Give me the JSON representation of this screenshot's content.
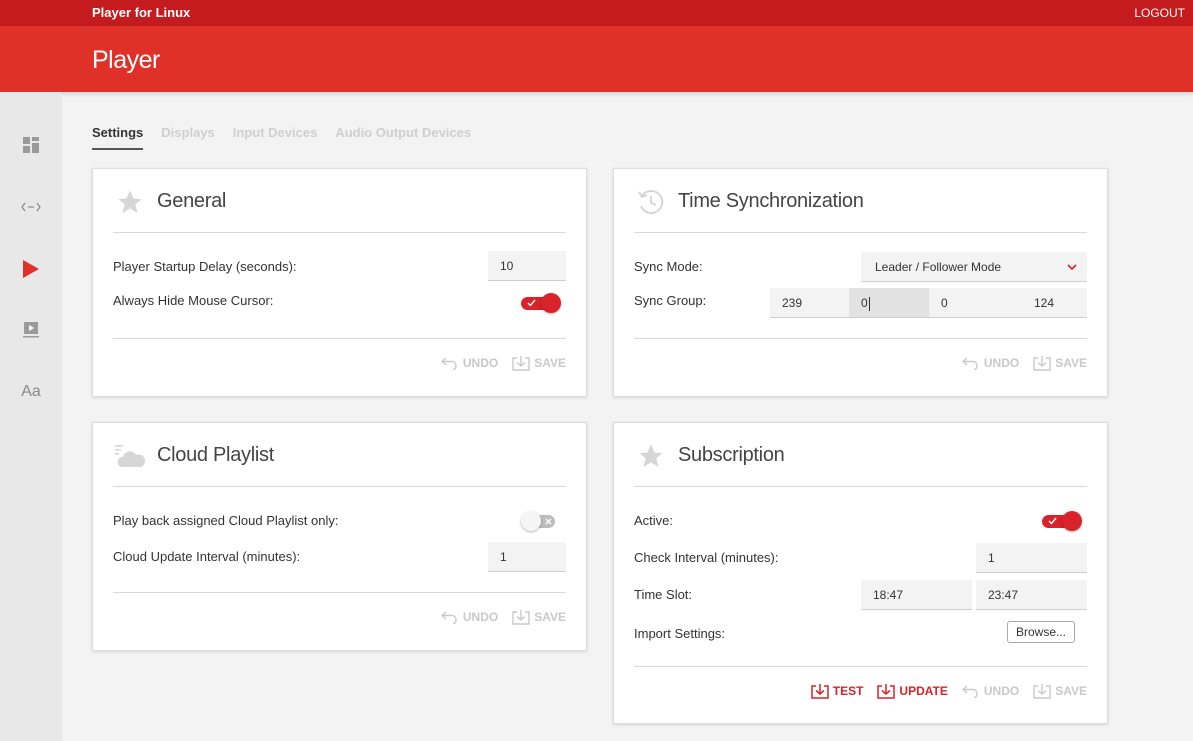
{
  "topbar": {
    "app_name": "Player for Linux",
    "logout": "LOGOUT"
  },
  "header": {
    "title": "Player"
  },
  "sidebar": {
    "items": [
      {
        "name": "dashboard-icon"
      },
      {
        "name": "code-arrows-icon"
      },
      {
        "name": "play-icon",
        "active": true
      },
      {
        "name": "presentation-icon"
      },
      {
        "name": "font-icon",
        "label": "Aa"
      }
    ]
  },
  "tabs": [
    "Settings",
    "Displays",
    "Input Devices",
    "Audio Output Devices"
  ],
  "general": {
    "title": "General",
    "startup_delay_label": "Player Startup Delay (seconds):",
    "startup_delay_value": "10",
    "hide_cursor_label": "Always Hide Mouse Cursor:",
    "hide_cursor_on": true,
    "undo": "UNDO",
    "save": "SAVE"
  },
  "time_sync": {
    "title": "Time Synchronization",
    "sync_mode_label": "Sync Mode:",
    "sync_mode_value": "Leader / Follower Mode",
    "sync_group_label": "Sync Group:",
    "sync_group_values": [
      "239",
      "0",
      "0",
      "124"
    ],
    "undo": "UNDO",
    "save": "SAVE"
  },
  "cloud_playlist": {
    "title": "Cloud Playlist",
    "assigned_only_label": "Play back assigned Cloud Playlist only:",
    "assigned_only_on": false,
    "update_interval_label": "Cloud Update Interval (minutes):",
    "update_interval_value": "1",
    "undo": "UNDO",
    "save": "SAVE"
  },
  "subscription": {
    "title": "Subscription",
    "active_label": "Active:",
    "active_on": true,
    "check_interval_label": "Check Interval (minutes):",
    "check_interval_value": "1",
    "time_slot_label": "Time Slot:",
    "time_slot_start": "18:47",
    "time_slot_end": "23:47",
    "import_label": "Import Settings:",
    "browse": "Browse...",
    "test": "TEST",
    "update": "UPDATE",
    "undo": "UNDO",
    "save": "SAVE"
  },
  "colors": {
    "topbar": "#c41c1e",
    "header": "#e03128",
    "accent": "#d8232a"
  }
}
